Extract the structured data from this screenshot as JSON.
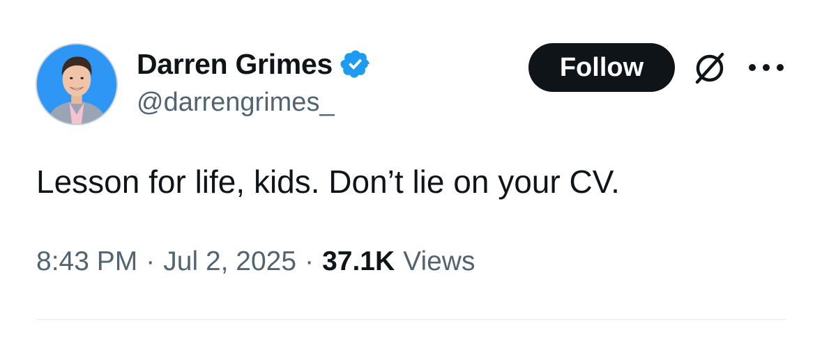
{
  "author": {
    "display_name": "Darren Grimes",
    "handle": "@darrengrimes_",
    "verified": true,
    "avatar_icon": "profile-photo"
  },
  "actions": {
    "follow_label": "Follow",
    "grok_icon": "grok-icon",
    "more_icon": "more-icon"
  },
  "tweet": {
    "text": "Lesson for life, kids. Don’t lie on your CV.",
    "time": "8:43 PM",
    "date": "Jul 2, 2025",
    "separator": "·",
    "views_count": "37.1K",
    "views_label": "Views"
  },
  "colors": {
    "text_primary": "#0f1419",
    "text_secondary": "#536471",
    "verified_badge": "#1d9bf0",
    "follow_button_bg": "#0f1419",
    "avatar_bg": "#2e97f5",
    "divider": "#eff3f4"
  }
}
